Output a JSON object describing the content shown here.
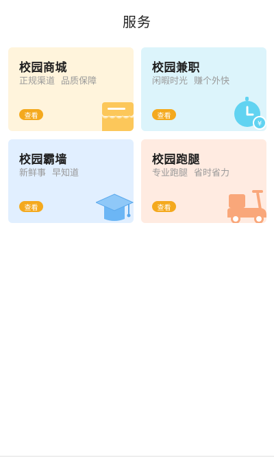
{
  "header": {
    "title": "服务"
  },
  "cards": [
    {
      "title": "校园商城",
      "tags": [
        "正规渠道",
        "品质保障"
      ],
      "button": "查看",
      "icon": "store-awning-icon",
      "color": "#fff4dc"
    },
    {
      "title": "校园兼职",
      "tags": [
        "闲暇时光",
        "赚个外快"
      ],
      "button": "查看",
      "icon": "clock-money-icon",
      "color": "#dcf4fb"
    },
    {
      "title": "校园霸墙",
      "tags": [
        "新鲜事",
        "早知道"
      ],
      "button": "查看",
      "icon": "graduation-cap-icon",
      "color": "#e1efff"
    },
    {
      "title": "校园跑腿",
      "tags": [
        "专业跑腿",
        "省时省力"
      ],
      "button": "查看",
      "icon": "scooter-icon",
      "color": "#ffebe1"
    }
  ],
  "colors": {
    "accent": "#f4a91e",
    "mall_icon": "#fcc75a",
    "job_icon": "#61d3f1",
    "wall_icon": "#6cb6f5",
    "run_icon": "#f9a77a"
  }
}
